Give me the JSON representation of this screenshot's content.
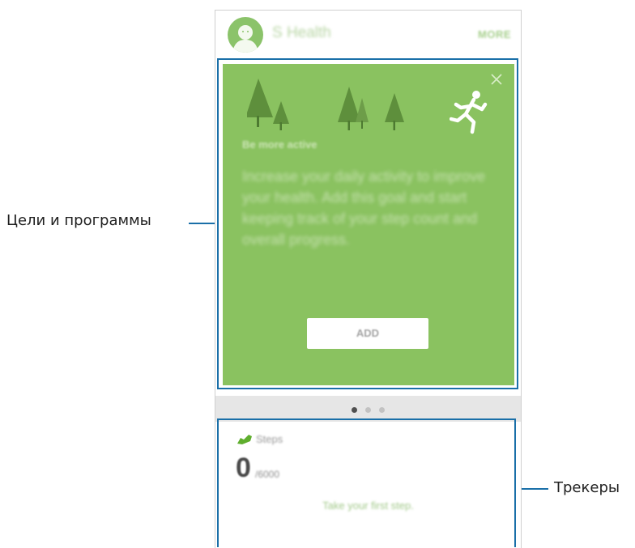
{
  "callouts": {
    "goals_label": "Цели и программы",
    "trackers_label": "Трекеры"
  },
  "app": {
    "title": "S Health",
    "more_label": "MORE"
  },
  "goal_card": {
    "subtitle": "Be more active",
    "body": "Increase your daily activity to improve your health. Add this goal and start keeping track of your step count and overall progress.",
    "add_label": "ADD"
  },
  "pager": {
    "pages": 3,
    "current": 1
  },
  "tracker": {
    "title": "Steps",
    "value": "0",
    "goal": "/6000",
    "prompt": "Take your first step."
  },
  "colors": {
    "accent_blue": "#1a6fa8",
    "card_green": "#8ac260",
    "tree_green": "#5e8f3c"
  },
  "icons": [
    "close-icon",
    "tree-icon",
    "runner-icon",
    "shoe-icon",
    "avatar-icon"
  ]
}
